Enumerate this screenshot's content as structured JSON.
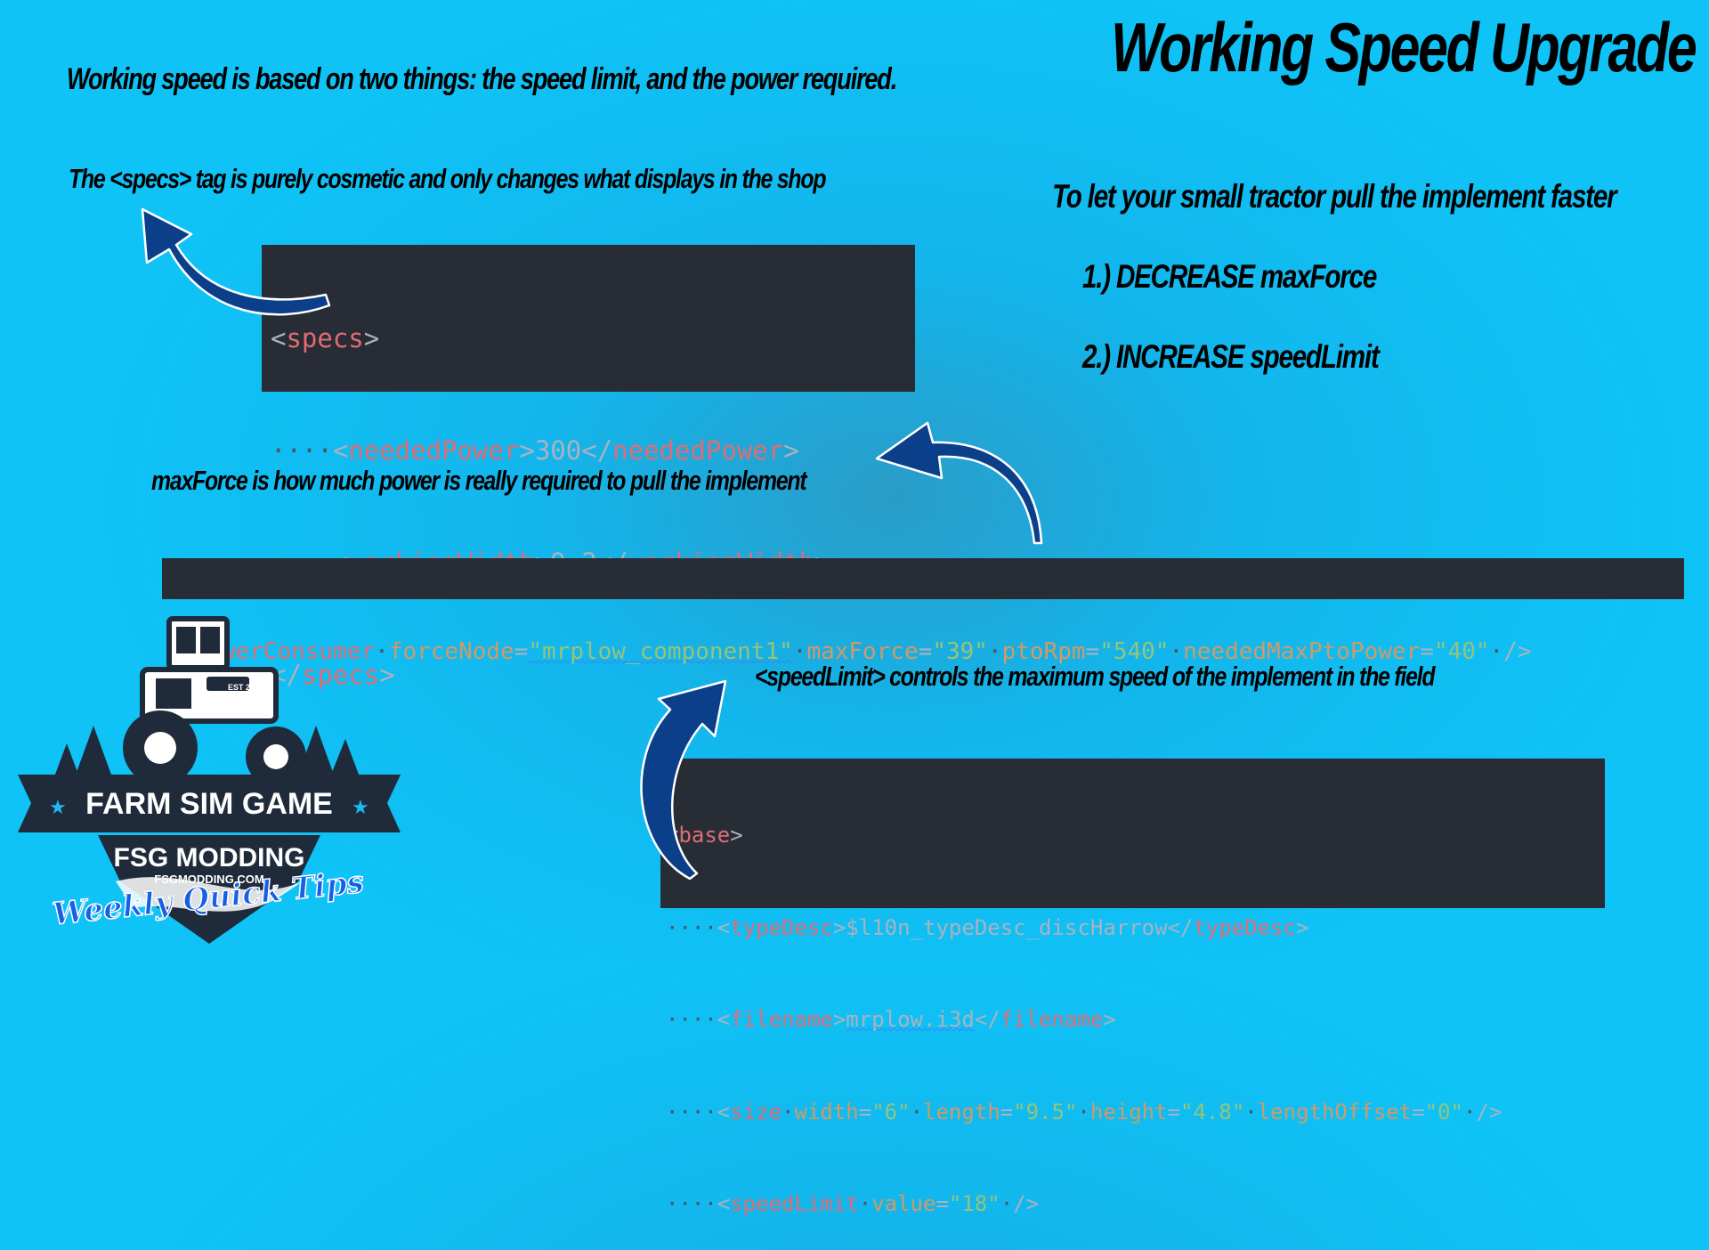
{
  "title": "Working Speed Upgrade",
  "captions": {
    "intro": "Working speed is based on two things: the speed limit, and the power required.",
    "specs": "The <specs> tag is purely cosmetic and only changes what displays in the shop",
    "goal": "To let your small tractor pull the implement faster",
    "step1": "1.) DECREASE maxForce",
    "step2": "2.) INCREASE speedLimit",
    "maxforce": "maxForce is how much power is really required to pull the implement",
    "speedlimit": "<speedLimit> controls the maximum speed of the implement in the field"
  },
  "specs_code": {
    "open_tag": "specs",
    "needed_power_tag": "neededPower",
    "needed_power_value": "300",
    "working_width_tag": "workingWidth",
    "working_width_value": "9.2",
    "close_tag": "specs"
  },
  "power_code": {
    "tag": "powerConsumer",
    "force_node_attr": "forceNode",
    "force_node_value": "\"mrplow_component1\"",
    "max_force_attr": "maxForce",
    "max_force_value": "\"39\"",
    "pto_rpm_attr": "ptoRpm",
    "pto_rpm_value": "\"540\"",
    "needed_max_pto_attr": "neededMaxPtoPower",
    "needed_max_pto_value": "\"40\""
  },
  "base_code": {
    "open_tag": "base",
    "type_desc_tag": "typeDesc",
    "type_desc_value": "$l10n_typeDesc_discHarrow",
    "filename_tag": "filename",
    "filename_value": "mrplow.i3d",
    "size_tag": "size",
    "width_attr": "width",
    "width_value": "\"6\"",
    "length_attr": "length",
    "length_value": "\"9.5\"",
    "height_attr": "height",
    "height_value": "\"4.8\"",
    "length_offset_attr": "lengthOffset",
    "length_offset_value": "\"0\"",
    "speed_limit_tag": "speedLimit",
    "value_attr": "value",
    "value_value": "\"18\""
  },
  "logo": {
    "brand": "FARM SIM GAME",
    "sub": "FSG MODDING",
    "url": "FSGMODDING.COM",
    "badge": "EST 2020",
    "script": "Weekly Quick Tips"
  },
  "colors": {
    "background": "#0fc3f7",
    "code_bg": "#282c34",
    "tag": "#e06c75",
    "attr": "#d19a66",
    "string": "#98c379",
    "arrow": "#0b3f8a"
  }
}
